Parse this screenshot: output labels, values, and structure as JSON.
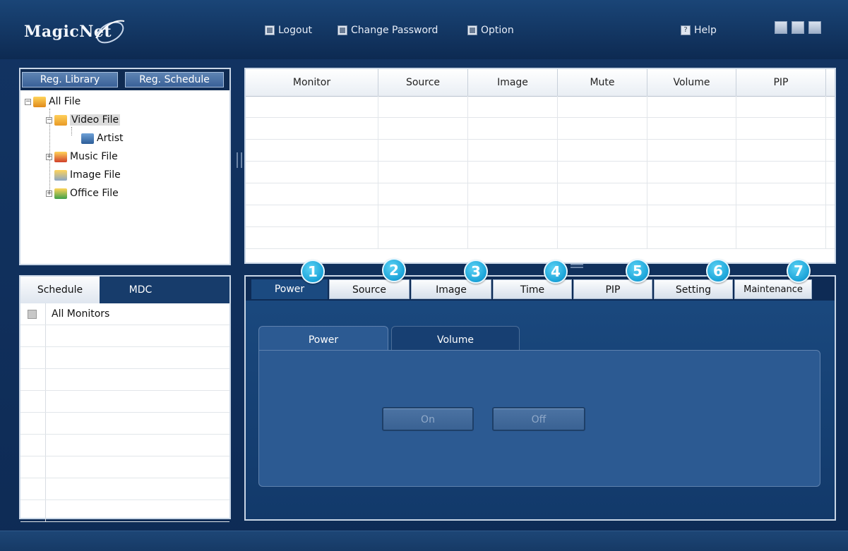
{
  "app": {
    "logo_text": "MagicNet"
  },
  "top_menu": {
    "logout": "Logout",
    "change_password": "Change Password",
    "option": "Option",
    "help": "Help"
  },
  "library": {
    "tabs": [
      "Reg. Library",
      "Reg. Schedule"
    ],
    "tree": {
      "root": "All File",
      "video": "Video File",
      "artist": "Artist",
      "music": "Music File",
      "image": "Image File",
      "office": "Office File"
    }
  },
  "monitor_grid": {
    "columns": [
      "Monitor",
      "Source",
      "Image",
      "Mute",
      "Volume",
      "PIP"
    ]
  },
  "schedule_panel": {
    "tabs": [
      "Schedule",
      "MDC"
    ],
    "first_row": "All Monitors"
  },
  "control_panel": {
    "tabs": [
      "Power",
      "Source",
      "Image",
      "Time",
      "PIP",
      "Setting",
      "Maintenance"
    ],
    "badges": [
      "1",
      "2",
      "3",
      "4",
      "5",
      "6",
      "7"
    ],
    "subtabs": [
      "Power",
      "Volume"
    ],
    "buttons": {
      "on": "On",
      "off": "Off"
    }
  },
  "colors": {
    "background": "#123463",
    "accent_badge": "#1aa3d8",
    "panel_blue": "#2c5a92"
  }
}
